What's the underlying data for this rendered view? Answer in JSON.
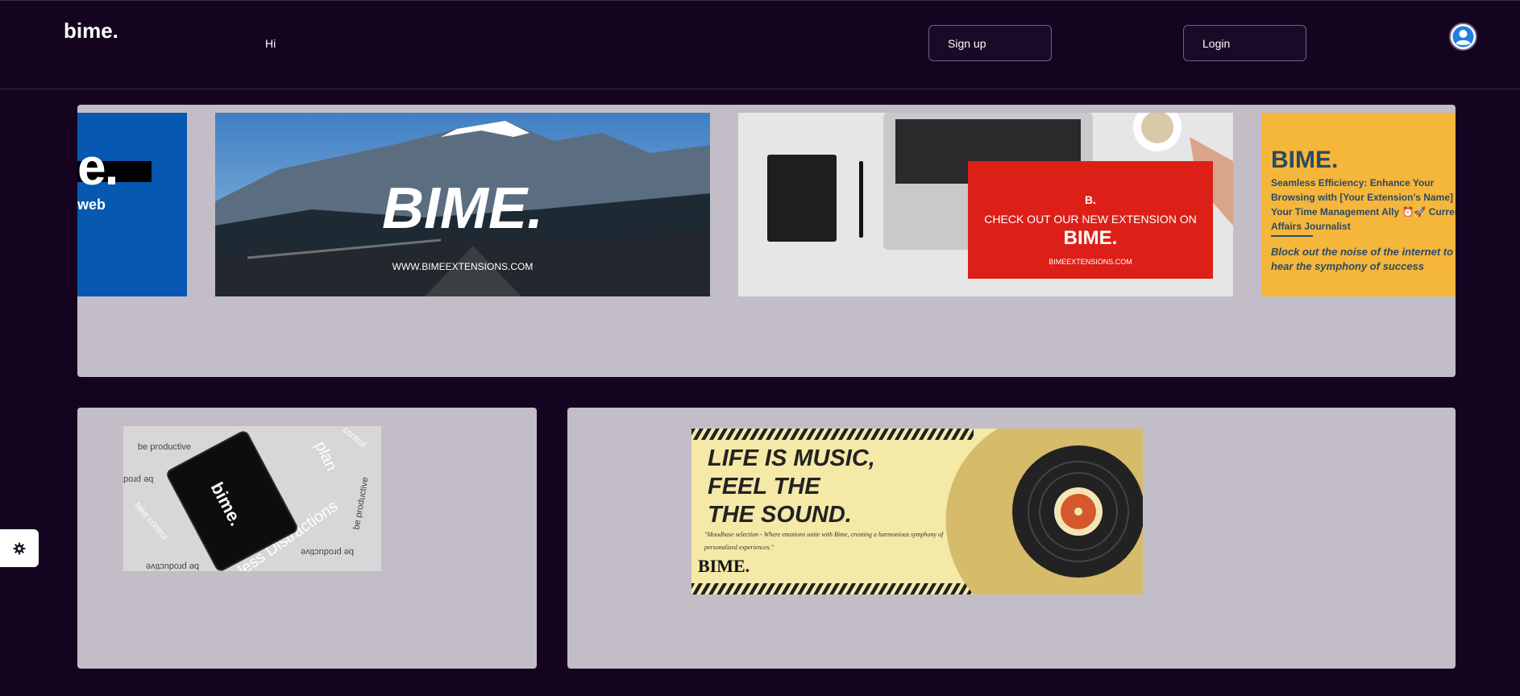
{
  "header": {
    "logo": "bime.",
    "greeting": "Hi",
    "signup_label": "Sign up",
    "login_label": "Login",
    "avatar_icon": "user-avatar-icon"
  },
  "carousel": {
    "slide1": {
      "big_text": "e.",
      "sub_text": "web"
    },
    "slide2": {
      "brand": "BIME.",
      "url": "WWW.BIMEEXTENSIONS.COM"
    },
    "slide3": {
      "flag": "B.",
      "line1": "CHECK OUT OUR NEW EXTENSION ON",
      "line2": "BIME.",
      "line3": "BIMEEXTENSIONS.COM"
    },
    "slide4": {
      "title": "BIME.",
      "text": "Seamless Efficiency: Enhance Your Browsing with [Your Extension's Name] - Your Time Management Ally ⏰🚀 Current Affairs Journalist",
      "quote": "Block out the noise of the internet to hear the symphony of success"
    }
  },
  "tablet_image": {
    "device_brand": "bime.",
    "words": [
      "be productive",
      "plan",
      "take control",
      "less Distractions",
      "be productive",
      "be prod",
      "be productive",
      "control",
      "be productive"
    ]
  },
  "music_banner": {
    "heading_1": "LIFE IS MUSIC,",
    "heading_2": "FEEL THE",
    "heading_3": "THE SOUND.",
    "subtitle": "\"Moodbase selection - Where emotions unite with Bime, creating a harmonious symphony of personalized experiences.\"",
    "brand": "BIME."
  },
  "settings": {
    "icon": "gear-icon"
  },
  "colors": {
    "background": "#15041f",
    "panel": "#c2bdc7",
    "slide1_blue": "#0658b0",
    "slide3_red": "#dc2018",
    "slide4_yellow": "#f5b63c",
    "music_yellow": "#f5e9a8"
  }
}
